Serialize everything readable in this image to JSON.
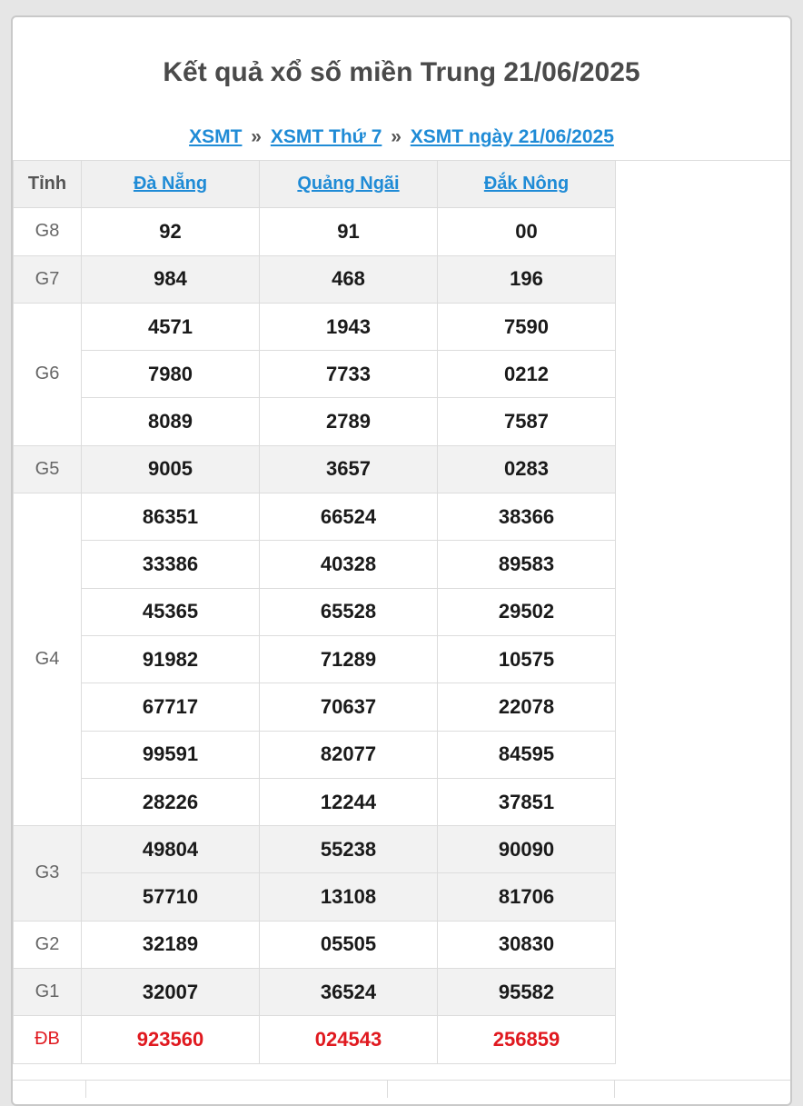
{
  "page": {
    "title": "Kết quả xổ số miền Trung 21/06/2025"
  },
  "breadcrumb": {
    "item1": "XSMT",
    "item2": "XSMT Thứ 7",
    "item3": "XSMT ngày 21/06/2025",
    "separator": "»"
  },
  "table": {
    "header_label": "Tỉnh",
    "provinces": [
      "Đà Nẵng",
      "Quảng Ngãi",
      "Đắk Nông"
    ],
    "prizes": [
      {
        "label": "G8",
        "rows": [
          [
            "92",
            "91",
            "00"
          ]
        ]
      },
      {
        "label": "G7",
        "rows": [
          [
            "984",
            "468",
            "196"
          ]
        ]
      },
      {
        "label": "G6",
        "rows": [
          [
            "4571",
            "1943",
            "7590"
          ],
          [
            "7980",
            "7733",
            "0212"
          ],
          [
            "8089",
            "2789",
            "7587"
          ]
        ]
      },
      {
        "label": "G5",
        "rows": [
          [
            "9005",
            "3657",
            "0283"
          ]
        ]
      },
      {
        "label": "G4",
        "rows": [
          [
            "86351",
            "66524",
            "38366"
          ],
          [
            "33386",
            "40328",
            "89583"
          ],
          [
            "45365",
            "65528",
            "29502"
          ],
          [
            "91982",
            "71289",
            "10575"
          ],
          [
            "67717",
            "70637",
            "22078"
          ],
          [
            "99591",
            "82077",
            "84595"
          ],
          [
            "28226",
            "12244",
            "37851"
          ]
        ]
      },
      {
        "label": "G3",
        "rows": [
          [
            "49804",
            "55238",
            "90090"
          ],
          [
            "57710",
            "13108",
            "81706"
          ]
        ]
      },
      {
        "label": "G2",
        "rows": [
          [
            "32189",
            "05505",
            "30830"
          ]
        ]
      },
      {
        "label": "G1",
        "rows": [
          [
            "32007",
            "36524",
            "95582"
          ]
        ]
      },
      {
        "label": "ĐB",
        "rows": [
          [
            "923560",
            "024543",
            "256859"
          ]
        ]
      }
    ]
  },
  "colors": {
    "link": "#1f8bd6",
    "special": "#e0191f",
    "shade": "#f2f2f2",
    "border": "#dcdcdc"
  }
}
